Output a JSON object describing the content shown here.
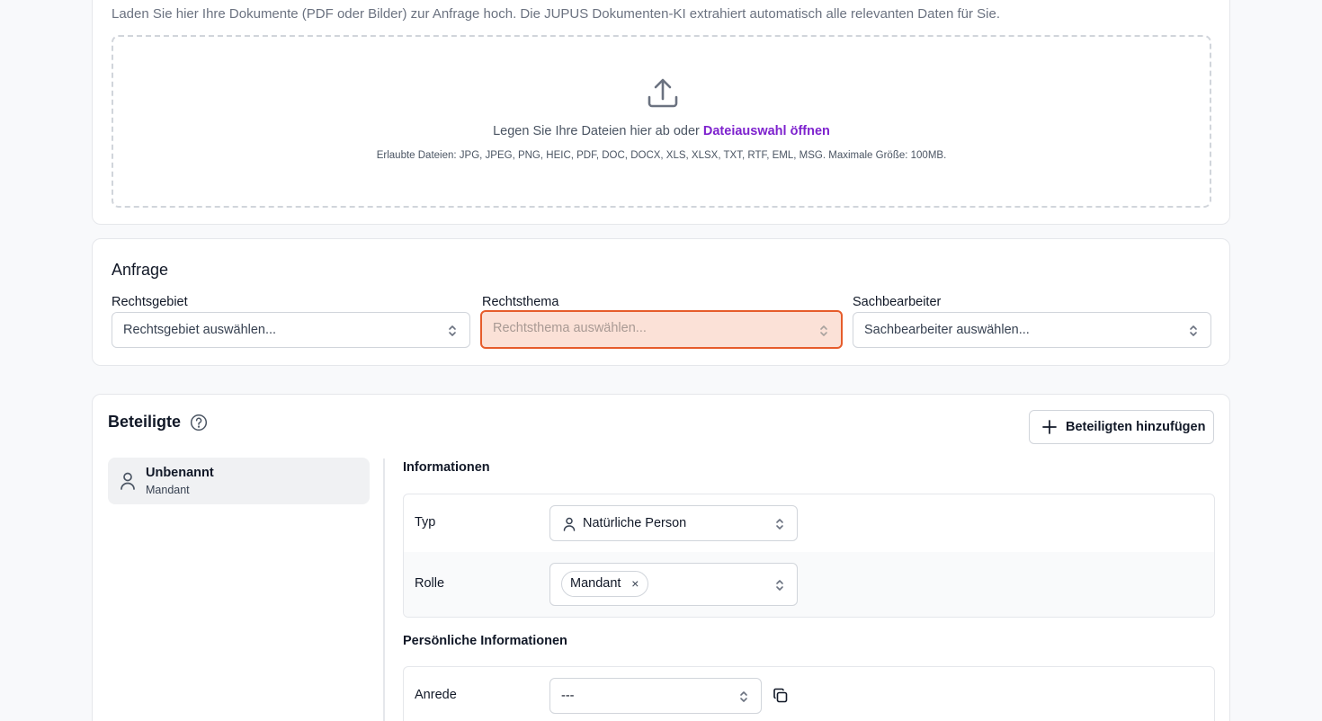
{
  "upload": {
    "description": "Laden Sie hier Ihre Dokumente (PDF oder Bilder) zur Anfrage hoch. Die JUPUS Dokumenten-KI extrahiert automatisch alle relevanten Daten für Sie.",
    "drop_text": "Legen Sie Ihre Dateien hier ab oder",
    "drop_link": "Dateiauswahl öffnen",
    "allowed_files": "Erlaubte Dateien: JPG, JPEG, PNG, HEIC, PDF, DOC, DOCX, XLS, XLSX, TXT, RTF, EML, MSG. Maximale Größe: 100MB.",
    "icon": "upload-icon"
  },
  "anfrage": {
    "title": "Anfrage",
    "fields": [
      {
        "label": "Rechtsgebiet",
        "placeholder": "Rechtsgebiet auswählen..."
      },
      {
        "label": "Rechtsthema",
        "placeholder": "Rechtsthema auswählen..."
      },
      {
        "label": "Sachbearbeiter",
        "placeholder": "Sachbearbeiter auswählen..."
      }
    ],
    "highlight_color": "#e65c2b"
  },
  "beteiligte": {
    "title": "Beteiligte",
    "add_button": "Beteiligten hinzufügen",
    "parties": [
      {
        "name": "Unbenannt",
        "role": "Mandant"
      }
    ],
    "informationen": {
      "title": "Informationen",
      "typ_label": "Typ",
      "typ_value": "Natürliche Person",
      "rolle_label": "Rolle",
      "rolle_chip": "Mandant",
      "chip_remove": "×"
    },
    "persoenlich": {
      "title": "Persönliche Informationen",
      "anrede_label": "Anrede",
      "anrede_value": "---"
    }
  },
  "colors": {
    "link": "#7e22ce",
    "border": "#e5e7eb",
    "background": "#f8f9fb"
  }
}
